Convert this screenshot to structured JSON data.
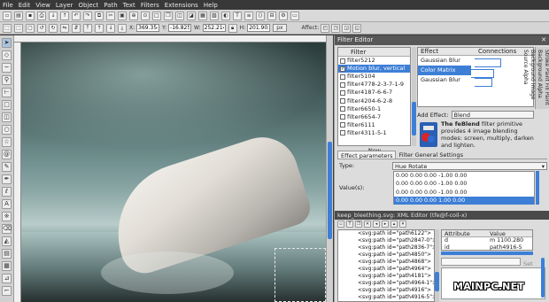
{
  "menubar": [
    "File",
    "Edit",
    "View",
    "Layer",
    "Object",
    "Path",
    "Text",
    "Filters",
    "Extensions",
    "Help"
  ],
  "controls": {
    "x_label": "X:",
    "x_value": "369.354",
    "y_label": "Y:",
    "y_value": "-16.825",
    "w_label": "W:",
    "w_value": "252.214",
    "h_label": "H:",
    "h_value": "201.902",
    "unit": "px",
    "affect_label": "Affect:"
  },
  "filter_editor": {
    "title": "Filter Editor",
    "filter_header": "Filter",
    "filters": [
      {
        "name": "filter5212",
        "checked": false,
        "selected": false
      },
      {
        "name": "Motion blur, vertical",
        "checked": true,
        "selected": true
      },
      {
        "name": "filter5104",
        "checked": false,
        "selected": false
      },
      {
        "name": "filter4778-2-3-7-1-9",
        "checked": false,
        "selected": false
      },
      {
        "name": "filter4187-6-6-7",
        "checked": false,
        "selected": false
      },
      {
        "name": "filter4204-6-2-8",
        "checked": false,
        "selected": false
      },
      {
        "name": "filter6650-1",
        "checked": false,
        "selected": false
      },
      {
        "name": "filter6654-7",
        "checked": false,
        "selected": false
      },
      {
        "name": "filter6111",
        "checked": false,
        "selected": false
      },
      {
        "name": "filter4311-5-1",
        "checked": false,
        "selected": false
      }
    ],
    "new_label": "New",
    "effect_header": "Effect",
    "connections_header": "Connections",
    "effects": [
      {
        "name": "Gaussian Blur",
        "selected": false
      },
      {
        "name": "Color Matrix",
        "selected": true
      },
      {
        "name": "Gaussian Blur",
        "selected": false
      }
    ],
    "side_tabs": "Stroke Paint  Fill Paint  Background Alpha  Background Image  Source Alpha",
    "add_effect_label": "Add Effect:",
    "add_effect_value": "Blend",
    "blend_desc_bold": "The feBlend",
    "blend_desc_rest": " filter primitive provides 4 image blending modes: screen, multiply, darken and lighten.",
    "tabs": [
      "Effect parameters",
      "Filter General Settings"
    ],
    "type_label": "Type:",
    "type_value": "Hue Rotate",
    "values_label": "Value(s):",
    "values": [
      {
        "text": "0.00 0.00 0.00 -1.00 0.00",
        "selected": false
      },
      {
        "text": "0.00 0.00 0.00 -1.00 0.00",
        "selected": false
      },
      {
        "text": "0.00 0.00 0.00 -1.00 0.00",
        "selected": false
      },
      {
        "text": "0.00 0.00 0.00  1.00  0.00",
        "selected": true
      }
    ]
  },
  "xml_editor": {
    "title": "keep_bleething.svg: XML Editor (tfe@f-coil-x)",
    "nodes": [
      "<svg:path id=\"path6122\">",
      "<svg:path id=\"path2847-0\">",
      "<svg:path id=\"path2836-7\">",
      "<svg:path id=\"path4850\">",
      "<svg:path id=\"path4868\">",
      "<svg:path id=\"path4964\">",
      "<svg:path id=\"path4181\">",
      "<svg:path id=\"path4964-1\">",
      "<svg:path id=\"path4916\">",
      "<svg:path id=\"path4916-5\">"
    ],
    "attr_header": "Attribute",
    "value_header": "Value",
    "attrs": [
      {
        "name": "d",
        "value": "m 1100.280"
      },
      {
        "name": "id",
        "value": "path4916-5"
      }
    ],
    "set_label": "Set"
  },
  "watermark": "MAINPC.NET",
  "colors": {
    "accent": "#3d7fd6",
    "menubar": "#383838",
    "panel": "#dcdcdc"
  }
}
